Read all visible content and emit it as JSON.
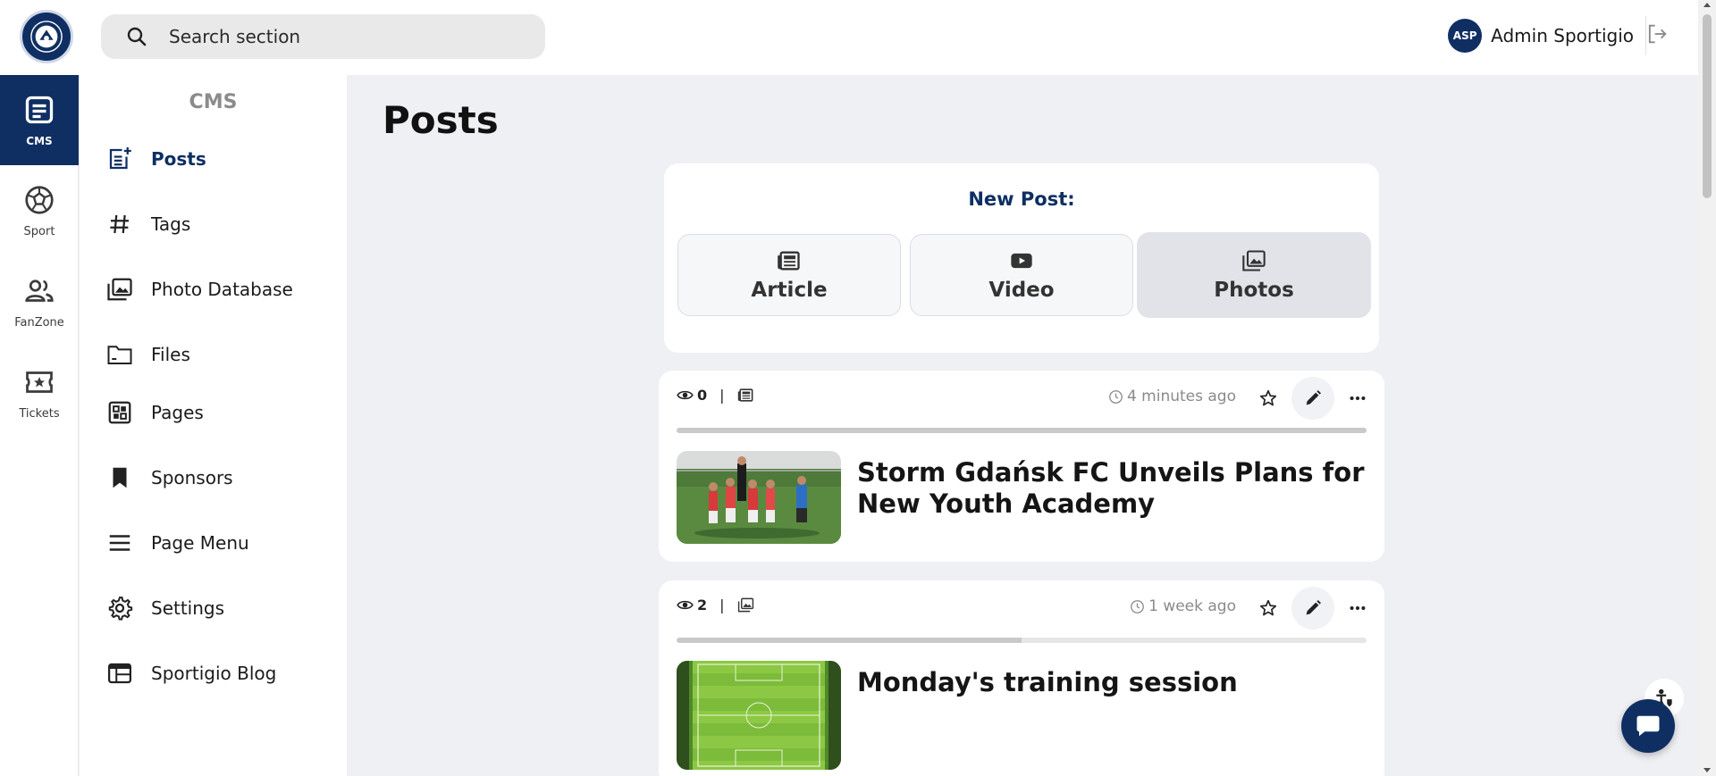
{
  "header": {
    "search_placeholder": "Search section",
    "user_initials": "ASP",
    "user_name": "Admin Sportigio"
  },
  "rail": {
    "items": [
      {
        "label": "CMS",
        "icon": "cms-icon"
      },
      {
        "label": "Sport",
        "icon": "ball-icon"
      },
      {
        "label": "FanZone",
        "icon": "users-icon"
      },
      {
        "label": "Tickets",
        "icon": "ticket-icon"
      }
    ]
  },
  "menu": {
    "title": "CMS",
    "items": [
      {
        "label": "Posts",
        "icon": "post-add-icon"
      },
      {
        "label": "Tags",
        "icon": "hashtag-icon"
      },
      {
        "label": "Photo Database",
        "icon": "photos-icon"
      },
      {
        "label": "Files",
        "icon": "folder-icon"
      },
      {
        "label": "Pages",
        "icon": "pages-icon"
      },
      {
        "label": "Sponsors",
        "icon": "bookmark-icon"
      },
      {
        "label": "Page Menu",
        "icon": "menu-icon"
      },
      {
        "label": "Settings",
        "icon": "gear-icon"
      },
      {
        "label": "Sportigio Blog",
        "icon": "web-icon"
      }
    ]
  },
  "main": {
    "title": "Posts",
    "new_post": {
      "label": "New Post:",
      "types": [
        {
          "label": "Article",
          "icon": "newspaper-icon"
        },
        {
          "label": "Video",
          "icon": "youtube-icon"
        },
        {
          "label": "Photos",
          "icon": "gallery-icon"
        }
      ]
    },
    "posts": [
      {
        "views": "0",
        "type_icon": "newspaper-icon",
        "time": "4 minutes ago",
        "title": "Storm Gdańsk FC Unveils Plans for New Youth Academy",
        "progress": 1.0
      },
      {
        "views": "2",
        "type_icon": "gallery-icon",
        "time": "1 week ago",
        "title": "Monday's training session",
        "progress": 0.5
      }
    ]
  },
  "colors": {
    "brand": "#0f2f63",
    "background": "#eff0f4"
  }
}
